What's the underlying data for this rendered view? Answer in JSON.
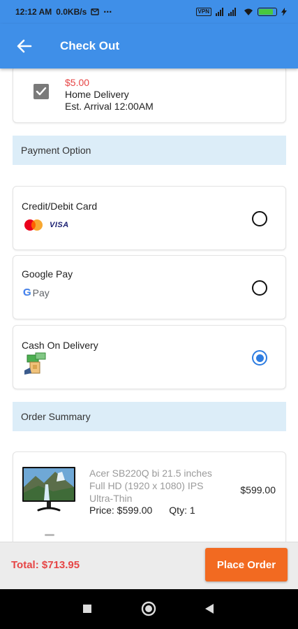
{
  "status_bar": {
    "time": "12:12 AM",
    "speed": "0.0KB/s",
    "dots": "⋯",
    "vpn": "VPN",
    "battery_level": 0.85
  },
  "app_bar": {
    "title": "Check Out"
  },
  "delivery": {
    "price": "$5.00",
    "method": "Home Delivery",
    "eta": "Est. Arrival 12:00AM",
    "checked": true
  },
  "payment": {
    "header": "Payment Option",
    "options": [
      {
        "label": "Credit/Debit Card",
        "logo_text": "VISA",
        "selected": false
      },
      {
        "label": "Google Pay",
        "logo_text": "Pay",
        "selected": false
      },
      {
        "label": "Cash On Delivery",
        "selected": true
      }
    ]
  },
  "order_summary": {
    "header": "Order Summary",
    "items": [
      {
        "name": "Acer SB220Q bi 21.5 inches Full HD (1920 x 1080) IPS Ultra-Thin",
        "price": "Price: $599.00",
        "qty": "Qty: 1",
        "total": "$599.00"
      }
    ]
  },
  "footer": {
    "total": "Total: $713.95",
    "place_order": "Place Order"
  },
  "colors": {
    "primary": "#3f8fe8",
    "accent": "#f26a21",
    "price_red": "#e64545",
    "radio_selected": "#2e7de1",
    "section_bg": "#dcedf8"
  }
}
